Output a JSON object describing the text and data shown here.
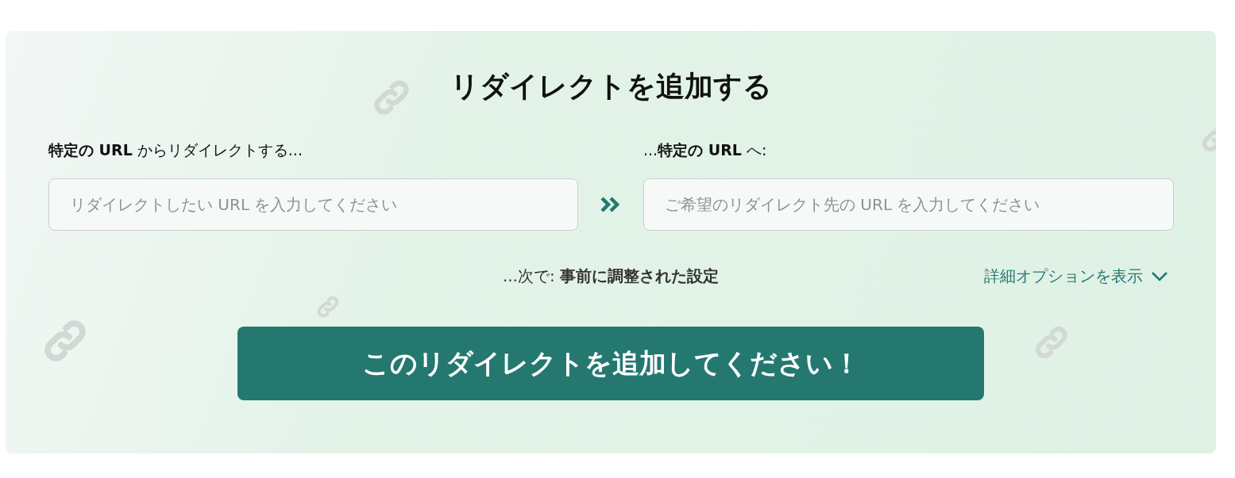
{
  "title": "リダイレクトを追加する",
  "from": {
    "label": "**特定の URL** からリダイレクトする...",
    "placeholder": "リダイレクトしたい URL を入力してください"
  },
  "to": {
    "label": "...**特定の URL** へ:",
    "placeholder": "ご希望のリダイレクト先の URL を入力してください"
  },
  "settings": {
    "text": "...次で: **事前に調整された設定**",
    "link": "詳細オプションを表示"
  },
  "submit": "このリダイレクトを追加してください！"
}
